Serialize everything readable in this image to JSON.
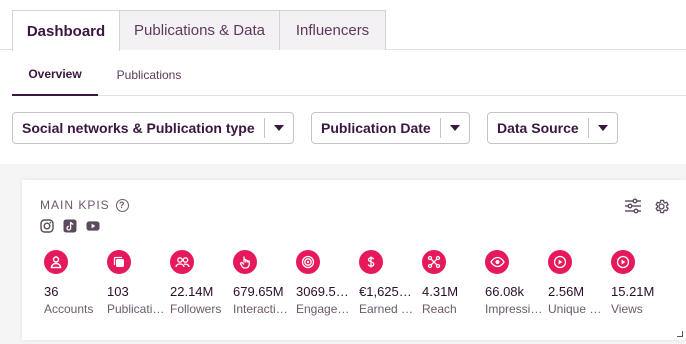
{
  "tabs": [
    {
      "label": "Dashboard",
      "active": true
    },
    {
      "label": "Publications & Data",
      "active": false
    },
    {
      "label": "Influencers",
      "active": false
    }
  ],
  "subtabs": [
    {
      "label": "Overview",
      "active": true
    },
    {
      "label": "Publications",
      "active": false
    }
  ],
  "filters": [
    {
      "label": "Social networks & Publication type"
    },
    {
      "label": "Publication Date"
    },
    {
      "label": "Data Source"
    }
  ],
  "card": {
    "title": "MAIN KPIS",
    "networks": [
      "instagram-icon",
      "tiktok-icon",
      "youtube-icon"
    ]
  },
  "kpis": [
    {
      "icon": "account-icon",
      "value": "36",
      "label": "Accounts"
    },
    {
      "icon": "publications-icon",
      "value": "103",
      "label": "Publications"
    },
    {
      "icon": "followers-icon",
      "value": "22.14M",
      "label": "Followers"
    },
    {
      "icon": "interactions-icon",
      "value": "679.65M",
      "label": "Interactions"
    },
    {
      "icon": "engagement-icon",
      "value": "3069.5…",
      "label": "Engagement"
    },
    {
      "icon": "earned-icon",
      "value": "€1,625…",
      "label": "Earned Media"
    },
    {
      "icon": "reach-icon",
      "value": "4.31M",
      "label": "Reach"
    },
    {
      "icon": "impressions-icon",
      "value": "66.08k",
      "label": "Impressions"
    },
    {
      "icon": "unique-views-icon",
      "value": "2.56M",
      "label": "Unique Views"
    },
    {
      "icon": "views-icon",
      "value": "15.21M",
      "label": "Views"
    }
  ],
  "colors": {
    "accent": "#e6195a",
    "text": "#3a1640"
  }
}
